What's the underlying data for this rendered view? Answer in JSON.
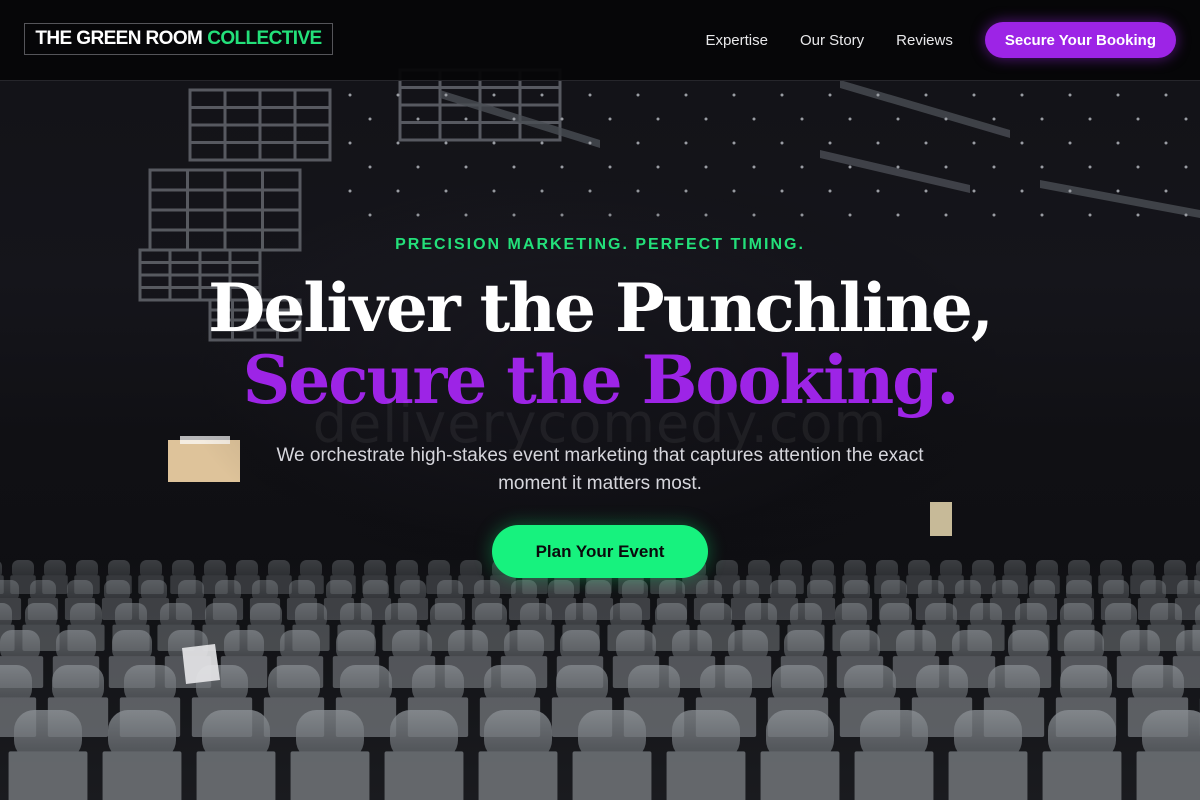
{
  "brand": {
    "name_part1": "THE GREEN ROOM",
    "name_part2": "COLLECTIVE"
  },
  "nav": {
    "links": [
      "Expertise",
      "Our Story",
      "Reviews"
    ],
    "cta_label": "Secure Your Booking"
  },
  "hero": {
    "eyebrow": "PRECISION MARKETING. PERFECT TIMING.",
    "headline_line1": "Deliver the Punchline,",
    "headline_line2": "Secure the Booking.",
    "watermark": "deliverycomedy.com",
    "subhead": "We orchestrate high-stakes event marketing that captures attention the exact moment it matters most.",
    "cta_label": "Plan Your Event"
  },
  "colors": {
    "accent_green": "#23e07a",
    "accent_purple": "#9d24e6",
    "cta_green": "#17f27e",
    "header_bg": "#050507"
  }
}
